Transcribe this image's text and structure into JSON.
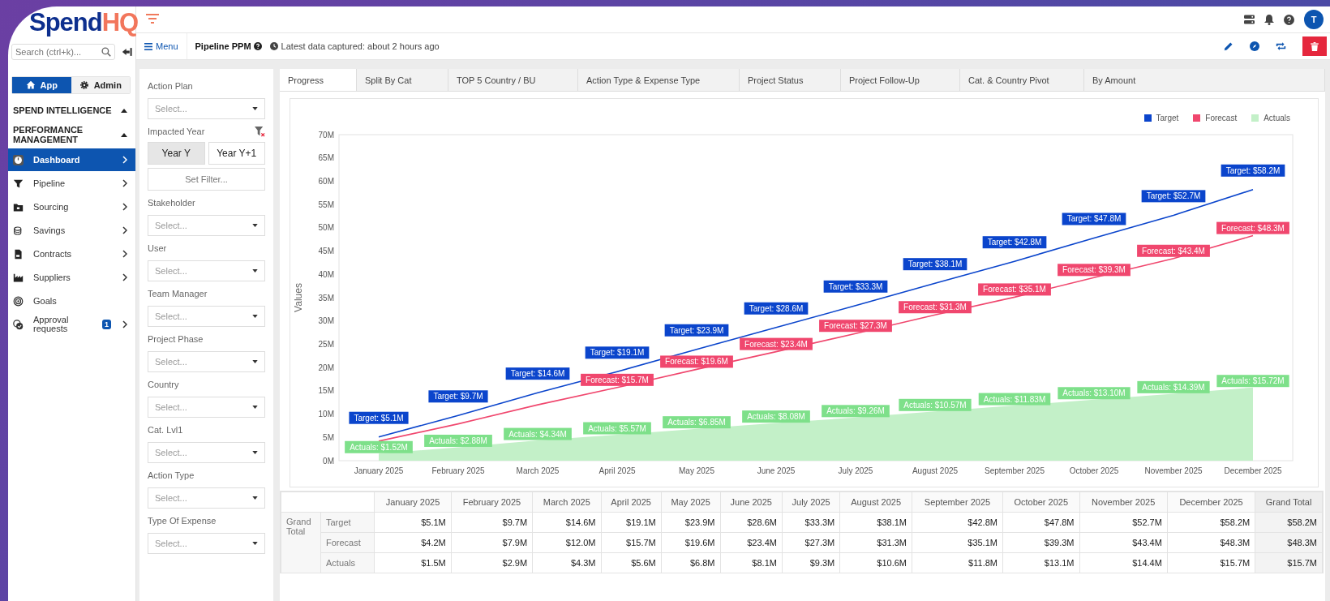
{
  "logo": {
    "part1": "Spend",
    "part2": "HQ"
  },
  "sidebar": {
    "search": {
      "placeholder": "Search (ctrl+k)..."
    },
    "modes": [
      {
        "label": "App",
        "selected": true
      },
      {
        "label": "Admin",
        "selected": false
      }
    ],
    "sections": [
      {
        "title": "SPEND INTELLIGENCE",
        "expanded": true
      },
      {
        "title": "PERFORMANCE MANAGEMENT",
        "expanded": true
      }
    ],
    "items": [
      {
        "label": "Dashboard",
        "selected": true,
        "has_children": true
      },
      {
        "label": "Pipeline",
        "selected": false,
        "has_children": true
      },
      {
        "label": "Sourcing",
        "selected": false,
        "has_children": true
      },
      {
        "label": "Savings",
        "selected": false,
        "has_children": true
      },
      {
        "label": "Contracts",
        "selected": false,
        "has_children": true
      },
      {
        "label": "Suppliers",
        "selected": false,
        "has_children": true
      },
      {
        "label": "Goals",
        "selected": false,
        "has_children": false
      },
      {
        "label": "Approval requests",
        "selected": false,
        "has_children": true,
        "badge": "1"
      }
    ]
  },
  "header": {
    "avatar": "T"
  },
  "toolbar": {
    "menu": "Menu",
    "title": "Pipeline PPM",
    "status": "Latest data captured: about 2 hours ago"
  },
  "filters": [
    {
      "kind": "select",
      "label": "Action Plan",
      "placeholder": "Select..."
    },
    {
      "kind": "year",
      "label": "Impacted Year",
      "options": [
        {
          "label": "Year Y",
          "selected": true
        },
        {
          "label": "Year Y+1",
          "selected": false
        }
      ],
      "button": "Set Filter..."
    },
    {
      "kind": "select",
      "label": "Stakeholder",
      "placeholder": "Select..."
    },
    {
      "kind": "select",
      "label": "User",
      "placeholder": "Select..."
    },
    {
      "kind": "select",
      "label": "Team Manager",
      "placeholder": "Select..."
    },
    {
      "kind": "select",
      "label": "Project Phase",
      "placeholder": "Select..."
    },
    {
      "kind": "select",
      "label": "Country",
      "placeholder": "Select..."
    },
    {
      "kind": "select",
      "label": "Cat. Lvl1",
      "placeholder": "Select..."
    },
    {
      "kind": "select",
      "label": "Action Type",
      "placeholder": "Select..."
    },
    {
      "kind": "select",
      "label": "Type Of Expense",
      "placeholder": "Select..."
    }
  ],
  "tabs": [
    {
      "label": "Progress",
      "selected": true
    },
    {
      "label": "Split By Cat",
      "selected": false
    },
    {
      "label": "TOP 5 Country / BU",
      "selected": false
    },
    {
      "label": "Action Type & Expense Type",
      "selected": false
    },
    {
      "label": "Project Status",
      "selected": false
    },
    {
      "label": "Project Follow-Up",
      "selected": false
    },
    {
      "label": "Cat. & Country Pivot",
      "selected": false
    },
    {
      "label": "By Amount",
      "selected": false
    }
  ],
  "chart_data": {
    "type": "line",
    "ylabel": "Values",
    "categories": [
      "January 2025",
      "February 2025",
      "March 2025",
      "April 2025",
      "May 2025",
      "June 2025",
      "July 2025",
      "August 2025",
      "September 2025",
      "October 2025",
      "November 2025",
      "December 2025"
    ],
    "ylim": [
      0,
      70
    ],
    "yticks": [
      {
        "value": 0,
        "label": "0M"
      },
      {
        "value": 5,
        "label": "5M"
      },
      {
        "value": 10,
        "label": "10M"
      },
      {
        "value": 15,
        "label": "15M"
      },
      {
        "value": 20,
        "label": "20M"
      },
      {
        "value": 25,
        "label": "25M"
      },
      {
        "value": 30,
        "label": "30M"
      },
      {
        "value": 35,
        "label": "35M"
      },
      {
        "value": 40,
        "label": "40M"
      },
      {
        "value": 45,
        "label": "45M"
      },
      {
        "value": 50,
        "label": "50M"
      },
      {
        "value": 55,
        "label": "55M"
      },
      {
        "value": 60,
        "label": "60M"
      },
      {
        "value": 65,
        "label": "65M"
      },
      {
        "value": 70,
        "label": "70M"
      }
    ],
    "legend": "top-right",
    "series": [
      {
        "name": "Target",
        "type": "line",
        "color": "#0b45cc",
        "values": [
          5.1,
          9.7,
          14.6,
          19.1,
          23.9,
          28.6,
          33.3,
          38.1,
          42.8,
          47.8,
          52.7,
          58.2
        ],
        "value_labels": [
          "Target: $5.1M",
          "Target: $9.7M",
          "Target: $14.6M",
          "Target: $19.1M",
          "Target: $23.9M",
          "Target: $28.6M",
          "Target: $33.3M",
          "Target: $38.1M",
          "Target: $42.8M",
          "Target: $47.8M",
          "Target: $52.7M",
          "Target: $58.2M"
        ]
      },
      {
        "name": "Forecast",
        "type": "line",
        "color": "#f0476e",
        "values": [
          4.2,
          7.9,
          12.0,
          15.7,
          19.6,
          23.4,
          27.3,
          31.3,
          35.1,
          39.3,
          43.4,
          48.3
        ],
        "value_labels": [
          null,
          null,
          null,
          "Forecast: $15.7M",
          "Forecast: $19.6M",
          "Forecast: $23.4M",
          "Forecast: $27.3M",
          "Forecast: $31.3M",
          "Forecast: $35.1M",
          "Forecast: $39.3M",
          "Forecast: $43.4M",
          "Forecast: $48.3M"
        ]
      },
      {
        "name": "Actuals",
        "type": "area",
        "color": "#c3f0c8",
        "values": [
          1.52,
          2.88,
          4.34,
          5.57,
          6.85,
          8.08,
          9.26,
          10.57,
          11.83,
          13.1,
          14.39,
          15.72
        ],
        "value_labels": [
          "Actuals: $1.52M",
          "Actuals: $2.88M",
          "Actuals: $4.34M",
          "Actuals: $5.57M",
          "Actuals: $6.85M",
          "Actuals: $8.08M",
          "Actuals: $9.26M",
          "Actuals: $10.57M",
          "Actuals: $11.83M",
          "Actuals: $13.10M",
          "Actuals: $14.39M",
          "Actuals: $15.72M"
        ]
      }
    ]
  },
  "table": {
    "columns": [
      "January 2025",
      "February 2025",
      "March 2025",
      "April 2025",
      "May 2025",
      "June 2025",
      "July 2025",
      "August 2025",
      "September 2025",
      "October 2025",
      "November 2025",
      "December 2025",
      "Grand Total"
    ],
    "row_group": "Grand Total",
    "rows": [
      {
        "label": "Target",
        "cells": [
          "$5.1M",
          "$9.7M",
          "$14.6M",
          "$19.1M",
          "$23.9M",
          "$28.6M",
          "$33.3M",
          "$38.1M",
          "$42.8M",
          "$47.8M",
          "$52.7M",
          "$58.2M",
          "$58.2M"
        ]
      },
      {
        "label": "Forecast",
        "cells": [
          "$4.2M",
          "$7.9M",
          "$12.0M",
          "$15.7M",
          "$19.6M",
          "$23.4M",
          "$27.3M",
          "$31.3M",
          "$35.1M",
          "$39.3M",
          "$43.4M",
          "$48.3M",
          "$48.3M"
        ]
      },
      {
        "label": "Actuals",
        "cells": [
          "$1.5M",
          "$2.9M",
          "$4.3M",
          "$5.6M",
          "$6.8M",
          "$8.1M",
          "$9.3M",
          "$10.6M",
          "$11.8M",
          "$13.1M",
          "$14.4M",
          "$15.7M",
          "$15.7M"
        ]
      }
    ]
  }
}
